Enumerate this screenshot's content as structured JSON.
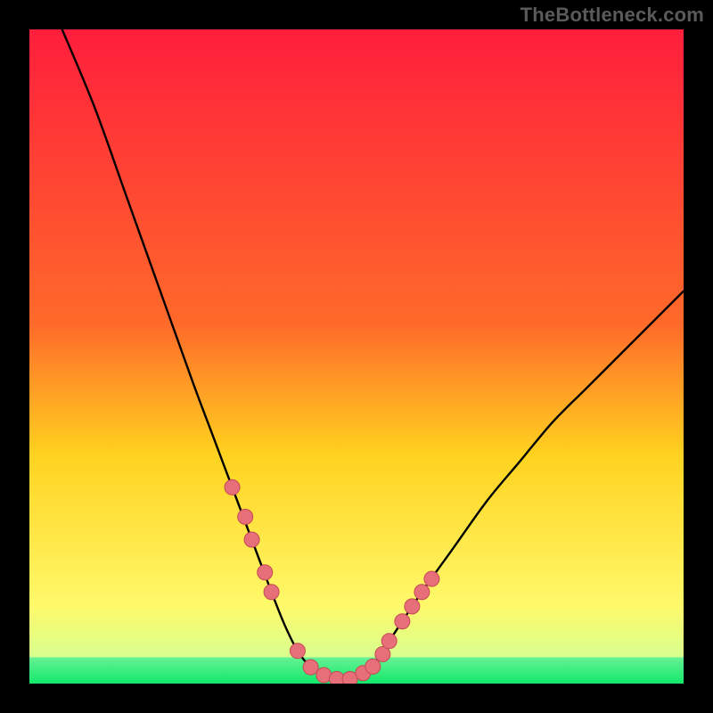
{
  "attribution": "TheBottleneck.com",
  "colors": {
    "bg": "#000000",
    "curve": "#000000",
    "marker_fill": "#e76f7a",
    "marker_stroke": "#c44a55",
    "grad_top": "#ff1e3c",
    "grad_mid1": "#ff6a2a",
    "grad_mid2": "#ffd21f",
    "grad_mid3": "#fff96a",
    "grad_bottom": "#12e86a",
    "attribution": "#5a5a5a"
  },
  "chart_data": {
    "type": "line",
    "title": "",
    "xlabel": "",
    "ylabel": "",
    "xlim": [
      0,
      100
    ],
    "ylim": [
      0,
      100
    ],
    "series": [
      {
        "name": "bottleneck-curve",
        "x": [
          5,
          10,
          15,
          20,
          25,
          28,
          31,
          34,
          37,
          39,
          41,
          43,
          45,
          47,
          49,
          51,
          53,
          55,
          60,
          65,
          70,
          75,
          80,
          85,
          90,
          95,
          100
        ],
        "y": [
          100,
          88,
          74,
          60,
          46,
          38,
          30,
          22,
          14,
          9,
          5,
          2.5,
          1.3,
          0.7,
          0.7,
          1.6,
          3.5,
          6.5,
          14,
          21,
          28,
          34,
          40,
          45,
          50,
          55,
          60
        ]
      }
    ],
    "markers": {
      "name": "sample-points",
      "x": [
        31,
        33,
        34,
        36,
        37,
        41,
        43,
        45,
        47,
        49,
        51,
        52.5,
        54,
        55,
        57,
        58.5,
        60,
        61.5
      ],
      "y": [
        30,
        25.5,
        22,
        17,
        14,
        5,
        2.5,
        1.3,
        0.7,
        0.7,
        1.6,
        2.6,
        4.5,
        6.5,
        9.5,
        11.8,
        14,
        16
      ]
    },
    "bands": [
      {
        "name": "red",
        "from": 100,
        "to": 55,
        "color_top": "#ff1e3c",
        "color_bottom": "#ff6a2a"
      },
      {
        "name": "orange",
        "from": 55,
        "to": 35,
        "color_top": "#ff6a2a",
        "color_bottom": "#ffd21f"
      },
      {
        "name": "yellow",
        "from": 35,
        "to": 12,
        "color_top": "#ffd21f",
        "color_bottom": "#fff96a"
      },
      {
        "name": "pale",
        "from": 12,
        "to": 4,
        "color_top": "#fff96a",
        "color_bottom": "#d8ff8f"
      },
      {
        "name": "green",
        "from": 4,
        "to": 0,
        "color_top": "#66f294",
        "color_bottom": "#12e86a"
      }
    ]
  }
}
